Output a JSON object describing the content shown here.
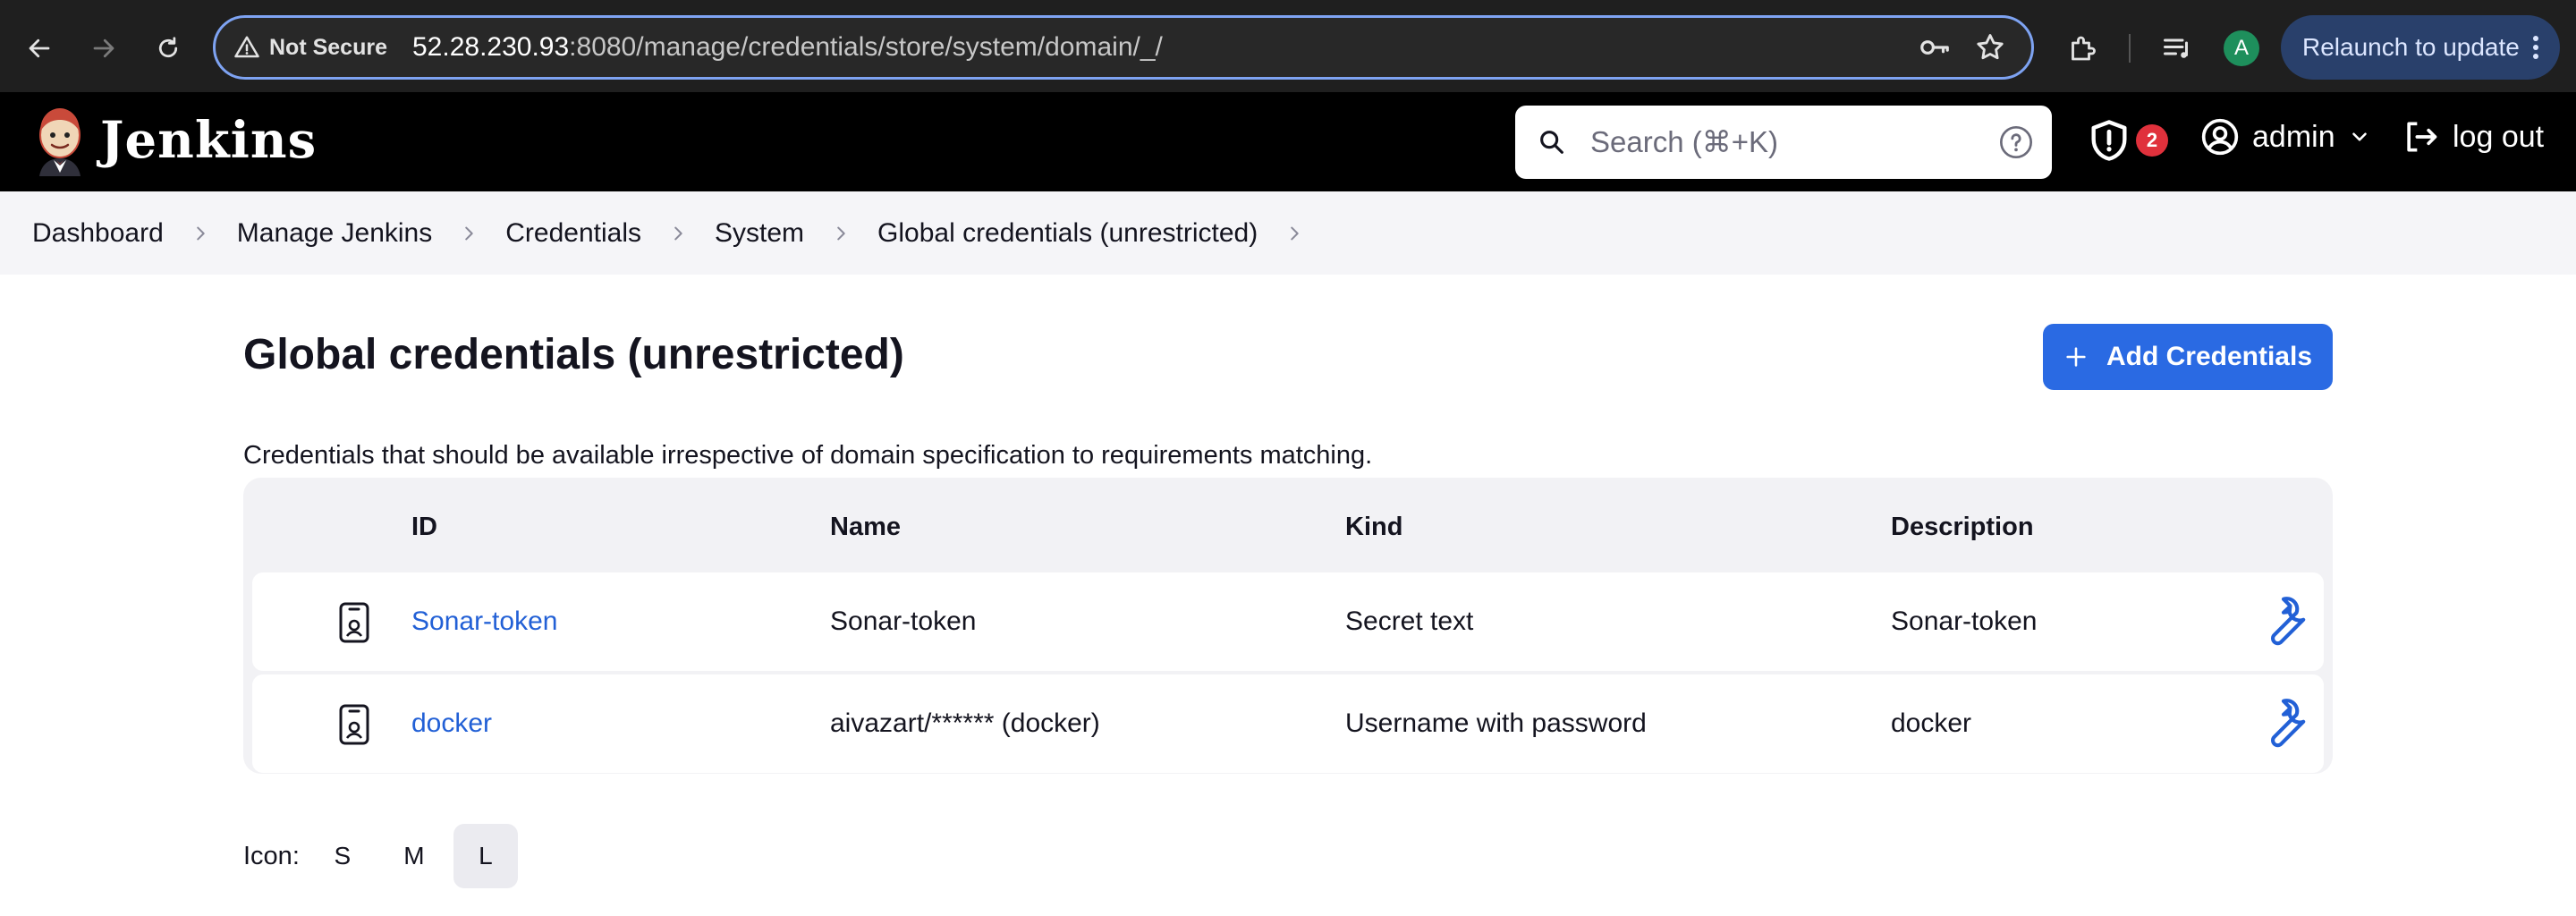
{
  "browser": {
    "security_label": "Not Secure",
    "url_host": "52.28.230.93",
    "url_path": ":8080/manage/credentials/store/system/domain/_/",
    "profile_initial": "A",
    "relaunch_label": "Relaunch to update"
  },
  "header": {
    "logo_text": "Jenkins",
    "search_placeholder": "Search (⌘+K)",
    "security_count": "2",
    "user_name": "admin",
    "logout_label": "log out"
  },
  "breadcrumb": [
    "Dashboard",
    "Manage Jenkins",
    "Credentials",
    "System",
    "Global credentials (unrestricted)"
  ],
  "main": {
    "title": "Global credentials (unrestricted)",
    "add_button": "Add Credentials",
    "description": "Credentials that should be available irrespective of domain specification to requirements matching."
  },
  "table": {
    "columns": [
      "ID",
      "Name",
      "Kind",
      "Description"
    ],
    "rows": [
      {
        "id": "Sonar-token",
        "name": "Sonar-token",
        "kind": "Secret text",
        "description": "Sonar-token"
      },
      {
        "id": "docker",
        "name": "aivazart/****** (docker)",
        "kind": "Username with password",
        "description": "docker"
      }
    ]
  },
  "icon_size": {
    "label": "Icon:",
    "options": [
      "S",
      "M",
      "L"
    ],
    "selected": "L"
  },
  "colors": {
    "accent": "#2a6ae3",
    "link": "#2260d6",
    "header_bg": "#000000",
    "badge": "#e0313c"
  }
}
